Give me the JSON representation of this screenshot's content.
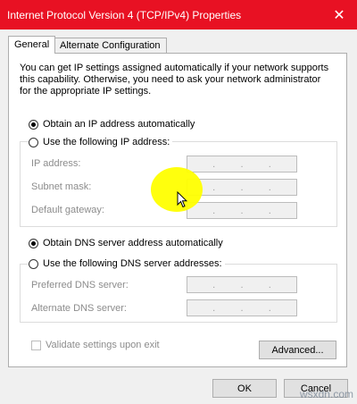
{
  "window": {
    "title": "Internet Protocol Version 4 (TCP/IPv4) Properties",
    "close_glyph": "✕"
  },
  "tabs": [
    {
      "label": "General"
    },
    {
      "label": "Alternate Configuration"
    }
  ],
  "description": "You can get IP settings assigned automatically if your network supports this capability. Otherwise, you need to ask your network administrator for the appropriate IP settings.",
  "ip": {
    "auto_label": "Obtain an IP address automatically",
    "manual_label": "Use the following IP address:",
    "fields": [
      {
        "label": "IP address:"
      },
      {
        "label": "Subnet mask:"
      },
      {
        "label": "Default gateway:"
      }
    ]
  },
  "dns": {
    "auto_label": "Obtain DNS server address automatically",
    "manual_label": "Use the following DNS server addresses:",
    "fields": [
      {
        "label": "Preferred DNS server:"
      },
      {
        "label": "Alternate DNS server:"
      }
    ]
  },
  "validate_label": "Validate settings upon exit",
  "buttons": {
    "advanced": "Advanced...",
    "ok": "OK",
    "cancel": "Cancel"
  },
  "watermark": "wsxdn.com",
  "colors": {
    "titlebar": "#e81123",
    "highlight": "#ffff00"
  }
}
